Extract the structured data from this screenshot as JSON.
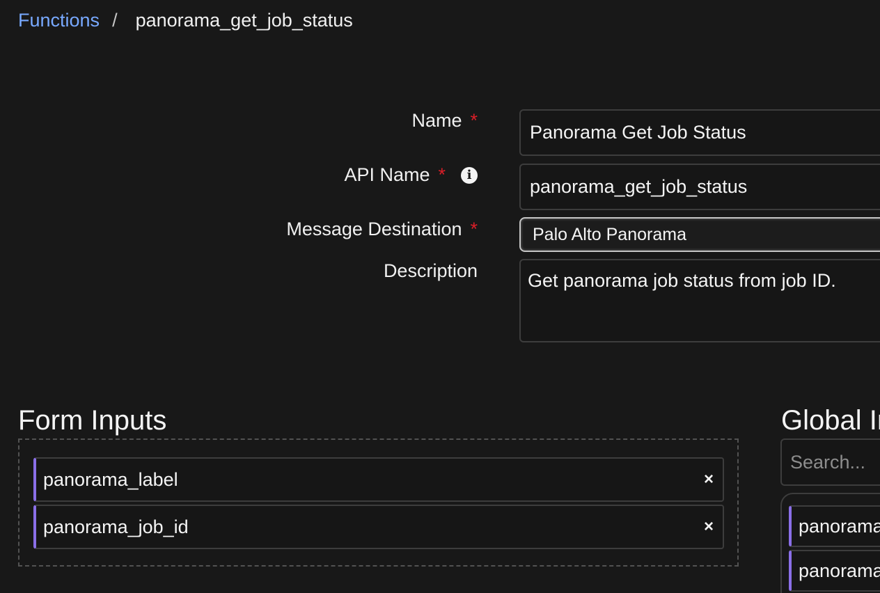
{
  "breadcrumb": {
    "root": "Functions",
    "separator": "/",
    "current": "panorama_get_job_status"
  },
  "form": {
    "name": {
      "label": "Name",
      "required_mark": "*",
      "value": "Panorama Get Job Status"
    },
    "api_name": {
      "label": "API Name",
      "required_mark": "*",
      "info_icon": "info-icon",
      "value": "panorama_get_job_status"
    },
    "message_destination": {
      "label": "Message Destination",
      "required_mark": "*",
      "selected": "Palo Alto Panorama"
    },
    "description": {
      "label": "Description",
      "value": "Get panorama job status from job ID."
    }
  },
  "form_inputs": {
    "title": "Form Inputs",
    "items": [
      {
        "label": "panorama_label",
        "remove": "×"
      },
      {
        "label": "panorama_job_id",
        "remove": "×"
      }
    ]
  },
  "global_inputs": {
    "title": "Global Inputs",
    "search_placeholder": "Search...",
    "items": [
      {
        "label": "panorama_action"
      },
      {
        "label": "panorama_address"
      }
    ]
  },
  "colors": {
    "background": "#181818",
    "link": "#78a9ff",
    "required": "#da1e28",
    "accent": "#8a6fe8",
    "border": "#3d3d3d"
  }
}
